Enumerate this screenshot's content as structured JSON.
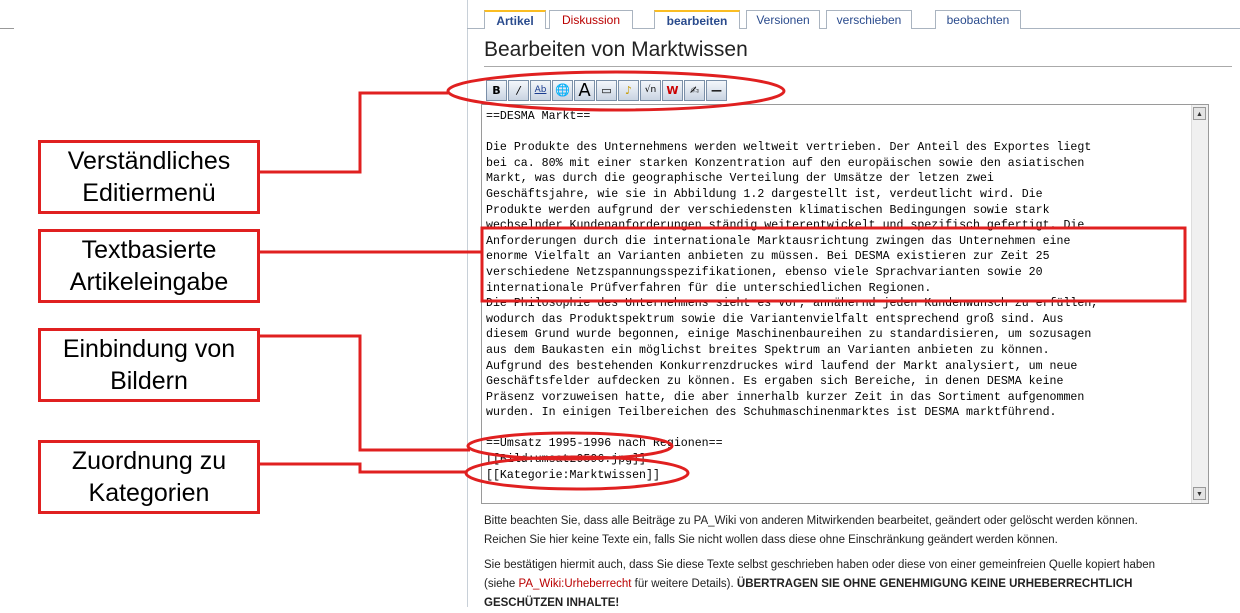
{
  "tabs": [
    {
      "label": "Artikel",
      "selected": true
    },
    {
      "label": "Diskussion",
      "red": true
    },
    {
      "label": "bearbeiten",
      "selected": true
    },
    {
      "label": "Versionen"
    },
    {
      "label": "verschieben"
    },
    {
      "label": "beobachten"
    }
  ],
  "page_title": "Bearbeiten von Marktwissen",
  "toolbar": [
    {
      "icon": "bold-icon",
      "glyph": "B"
    },
    {
      "icon": "italic-icon",
      "glyph": "/"
    },
    {
      "icon": "internal-link-icon",
      "glyph": "Ab"
    },
    {
      "icon": "external-link-icon",
      "glyph": "🌐"
    },
    {
      "icon": "headline-icon",
      "glyph": "A"
    },
    {
      "icon": "image-icon",
      "glyph": "▭"
    },
    {
      "icon": "media-icon",
      "glyph": "♪"
    },
    {
      "icon": "math-icon",
      "glyph": "√n"
    },
    {
      "icon": "nowiki-icon",
      "glyph": "W"
    },
    {
      "icon": "signature-icon",
      "glyph": "✍"
    },
    {
      "icon": "horizontal-line-icon",
      "glyph": "—"
    }
  ],
  "editor_lines": [
    "==DESMA Markt==",
    "",
    "Die Produkte des Unternehmens werden weltweit vertrieben. Der Anteil des Exportes liegt",
    "bei ca. 80% mit einer starken Konzentration auf den europäischen sowie den asiatischen",
    "Markt, was durch die geographische Verteilung der Umsätze der letzen zwei",
    "Geschäftsjahre, wie sie in Abbildung 1.2 dargestellt ist, verdeutlicht wird. Die",
    "Produkte werden aufgrund der verschiedensten klimatischen Bedingungen sowie stark",
    "wechselnder Kundenanforderungen ständig weiterentwickelt und spezifisch gefertigt. Die",
    "Anforderungen durch die internationale Marktausrichtung zwingen das Unternehmen eine",
    "enorme Vielfalt an Varianten anbieten zu müssen. Bei DESMA existieren zur Zeit 25",
    "verschiedene Netzspannungsspezifikationen, ebenso viele Sprachvarianten sowie 20",
    "internationale Prüfverfahren für die unterschiedlichen Regionen.",
    "Die Philosophie des Unternehmens sieht es vor, annähernd jeden Kundenwunsch zu erfüllen,",
    "wodurch das Produktspektrum sowie die Variantenvielfalt entsprechend groß sind. Aus",
    "diesem Grund wurde begonnen, einige Maschinenbaureihen zu standardisieren, um sozusagen",
    "aus dem Baukasten ein möglichst breites Spektrum an Varianten anbieten zu können.",
    "Aufgrund des bestehenden Konkurrenzdruckes wird laufend der Markt analysiert, um neue",
    "Geschäftsfelder aufdecken zu können. Es ergaben sich Bereiche, in denen DESMA keine",
    "Präsenz vorzuweisen hatte, die aber innerhalb kurzer Zeit in das Sortiment aufgenommen",
    "wurden. In einigen Teilbereichen des Schuhmaschinenmarktes ist DESMA marktführend.",
    "",
    "==Umsatz 1995-1996 nach Regionen==",
    "[[Bild:umsatz9596.jpg]]",
    "[[Kategorie:Marktwissen]]"
  ],
  "notice": {
    "line1": "Bitte beachten Sie, dass alle Beiträge zu PA_Wiki von anderen Mitwirkenden bearbeitet, geändert oder gelöscht werden können.",
    "line2": "Reichen Sie hier keine Texte ein, falls Sie nicht wollen dass diese ohne Einschränkung geändert werden können.",
    "line3": "Sie bestätigen hiermit auch, dass Sie diese Texte selbst geschrieben haben oder diese von einer gemeinfreien Quelle kopiert haben",
    "line4_pre": "(siehe ",
    "line4_link": "PA_Wiki:Urheberrecht",
    "line4_mid": " für weitere Details). ",
    "line4_bold": "ÜBERTRAGEN SIE OHNE GENEHMIGUNG KEINE URHEBERRECHTLICH",
    "line5_bold": "GESCHÜTZEN INHALTE!"
  },
  "callouts": [
    {
      "line1": "Verständliches",
      "line2": "Editiermenü"
    },
    {
      "line1": "Textbasierte",
      "line2": "Artikeleingabe"
    },
    {
      "line1": "Einbindung von",
      "line2": "Bildern"
    },
    {
      "line1": "Zuordnung zu",
      "line2": "Kategorien"
    }
  ],
  "colors": {
    "annotation_red": "#e02020",
    "tab_accent": "#fabd23",
    "link_blue": "#2a4b8d",
    "redlink": "#ba0000"
  }
}
